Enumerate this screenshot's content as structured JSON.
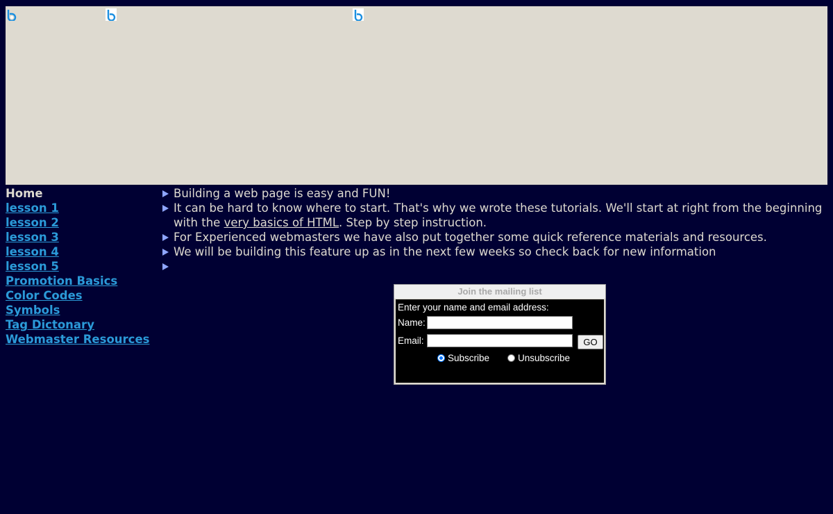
{
  "nav": {
    "current": "Home",
    "links": [
      "lesson 1",
      "lesson 2",
      "lesson 3",
      "lesson 4",
      "lesson 5",
      "Promotion Basics",
      "Color Codes",
      "Symbols",
      "Tag Dictonary",
      "Webmaster Resources"
    ]
  },
  "content": {
    "bullet1": "Building a web page is easy and FUN!",
    "bullet2_pre": "It can be hard to know where to start. That's why we wrote these tutorials. We'll start at right from the beginning with the ",
    "bullet2_link": "very basics of HTML",
    "bullet2_post": ". Step by step instruction.",
    "bullet3": "For Experienced webmasters we have also put together some quick reference materials and resources.",
    "bullet4": "We will be building this feature up as in the next few weeks so check back for new information",
    "bullet5": ""
  },
  "mailing": {
    "title": "Join the mailing list",
    "intro": "Enter your name and email address:",
    "name_label": "Name:",
    "name_value": "",
    "email_label": "Email:",
    "email_value": "",
    "go_label": "GO",
    "subscribe_label": "Subscribe",
    "unsubscribe_label": "Unsubscribe",
    "selected": "Subscribe"
  },
  "icons": {
    "banner_images": [
      "broken-image-icon",
      "broken-image-icon",
      "broken-image-icon"
    ]
  },
  "colors": {
    "background": "#000033",
    "banner": "#dedad0",
    "link": "#2b9ad8",
    "bullet": "#8fa6ff",
    "text": "#dedad0"
  }
}
